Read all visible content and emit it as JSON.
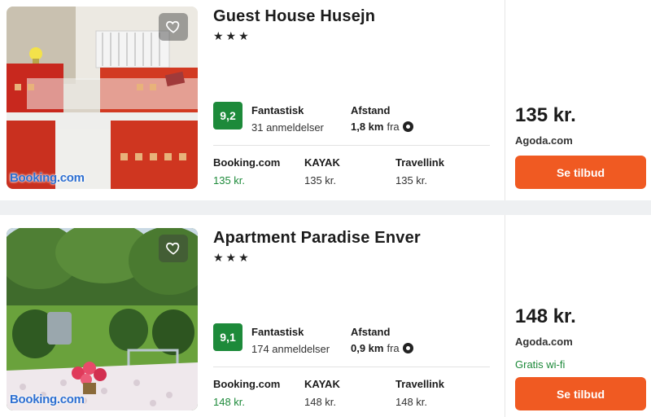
{
  "listings": [
    {
      "name": "Guest House Husejn",
      "stars": "★★★",
      "photo_brand": "Booking.com",
      "score": "9,2",
      "rating_word": "Fantastisk",
      "reviews": "31 anmeldelser",
      "distance_label": "Afstand",
      "distance_value": "1,8 km",
      "distance_suffix": "fra",
      "providers": [
        {
          "name": "Booking.com",
          "price": "135 kr."
        },
        {
          "name": "KAYAK",
          "price": "135 kr."
        },
        {
          "name": "Travellink",
          "price": "135 kr."
        }
      ],
      "price": "135 kr.",
      "site": "Agoda.com",
      "perk": "",
      "button": "Se tilbud"
    },
    {
      "name": "Apartment Paradise Enver",
      "stars": "★★★",
      "photo_brand": "Booking.com",
      "score": "9,1",
      "rating_word": "Fantastisk",
      "reviews": "174 anmeldelser",
      "distance_label": "Afstand",
      "distance_value": "0,9 km",
      "distance_suffix": "fra",
      "providers": [
        {
          "name": "Booking.com",
          "price": "148 kr."
        },
        {
          "name": "KAYAK",
          "price": "148 kr."
        },
        {
          "name": "Travellink",
          "price": "148 kr."
        }
      ],
      "price": "148 kr.",
      "site": "Agoda.com",
      "perk": "Gratis wi-fi",
      "button": "Se tilbud"
    }
  ],
  "colors": {
    "score_badge": "#1d8a3a",
    "cta": "#f05a22",
    "best_price": "#1d8a3a",
    "brand_blue": "#2d6fd1"
  },
  "icons": {
    "favorite": "heart-outline-icon",
    "distance": "location-target-icon"
  }
}
